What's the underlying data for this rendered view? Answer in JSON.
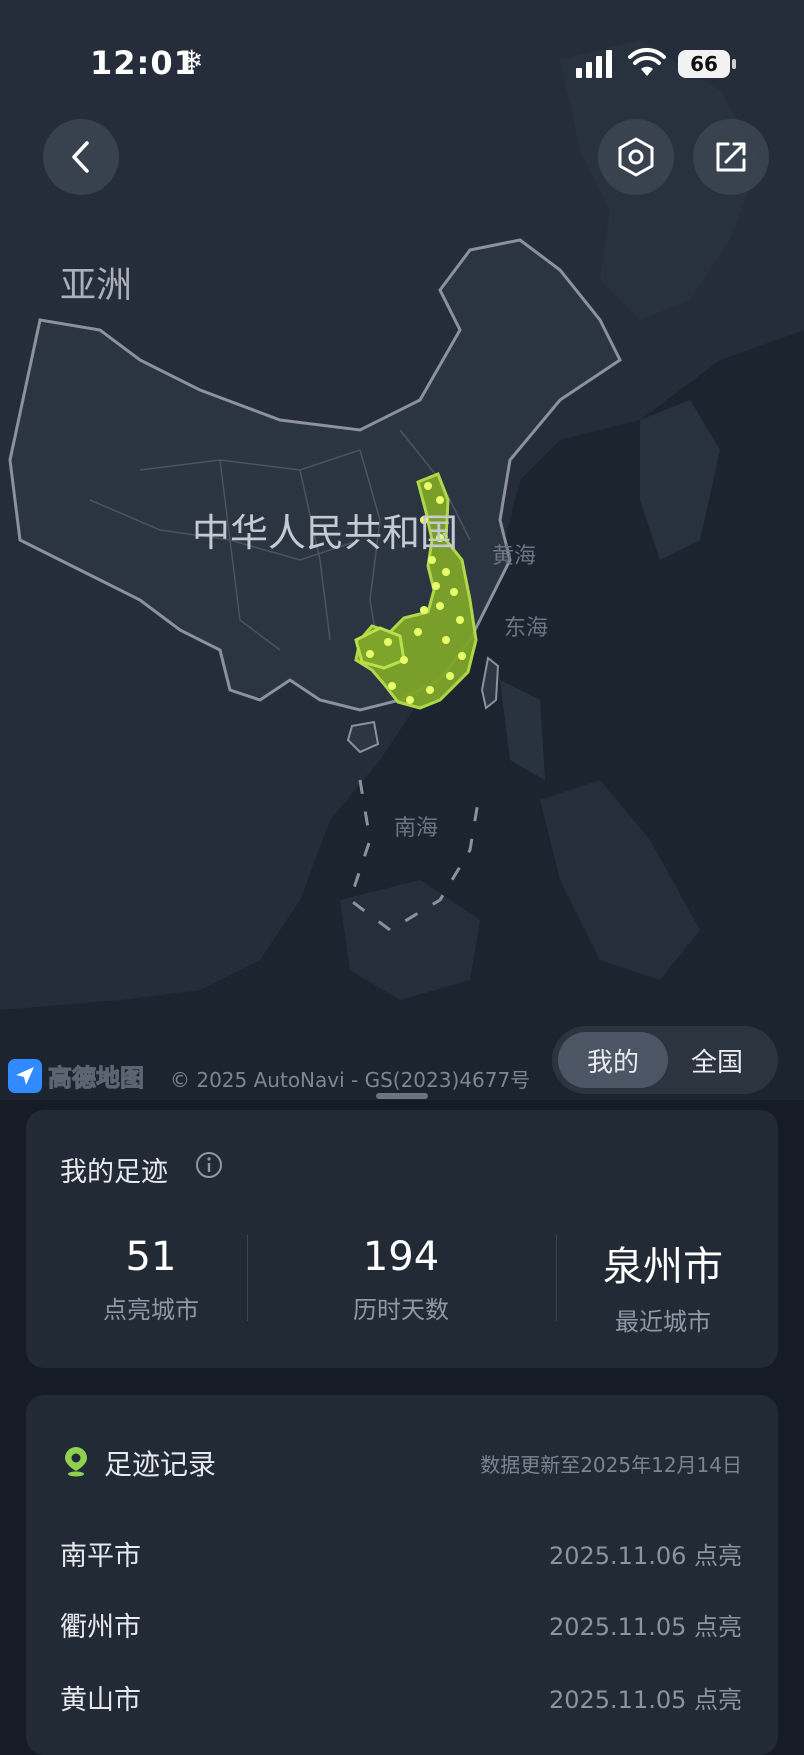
{
  "status_bar": {
    "time": "12:01",
    "snow_icon": "❄",
    "battery": "66"
  },
  "map": {
    "labels": {
      "asia": "亚洲",
      "china": "中华人民共和国",
      "yellow_sea": "黄海",
      "east_sea": "东海",
      "south_sea": "南海"
    },
    "provider_name": "高德地图",
    "copyright": "© 2025 AutoNavi - GS(2023)4677号",
    "highlight_color": "#a6d432"
  },
  "toggle": {
    "mine": "我的",
    "national": "全国"
  },
  "summary": {
    "title": "我的足迹",
    "stats": [
      {
        "value": "51",
        "label": "点亮城市"
      },
      {
        "value": "194",
        "label": "历时天数"
      },
      {
        "value": "泉州市",
        "label": "最近城市"
      }
    ]
  },
  "records": {
    "title": "足迹记录",
    "updated": "数据更新至2025年12月14日",
    "items": [
      {
        "city": "南平市",
        "date": "2025.11.06 点亮"
      },
      {
        "city": "衢州市",
        "date": "2025.11.05 点亮"
      },
      {
        "city": "黄山市",
        "date": "2025.11.05 点亮"
      }
    ]
  },
  "colors": {
    "accent_green": "#8fd14f",
    "card_bg": "#222a35"
  }
}
